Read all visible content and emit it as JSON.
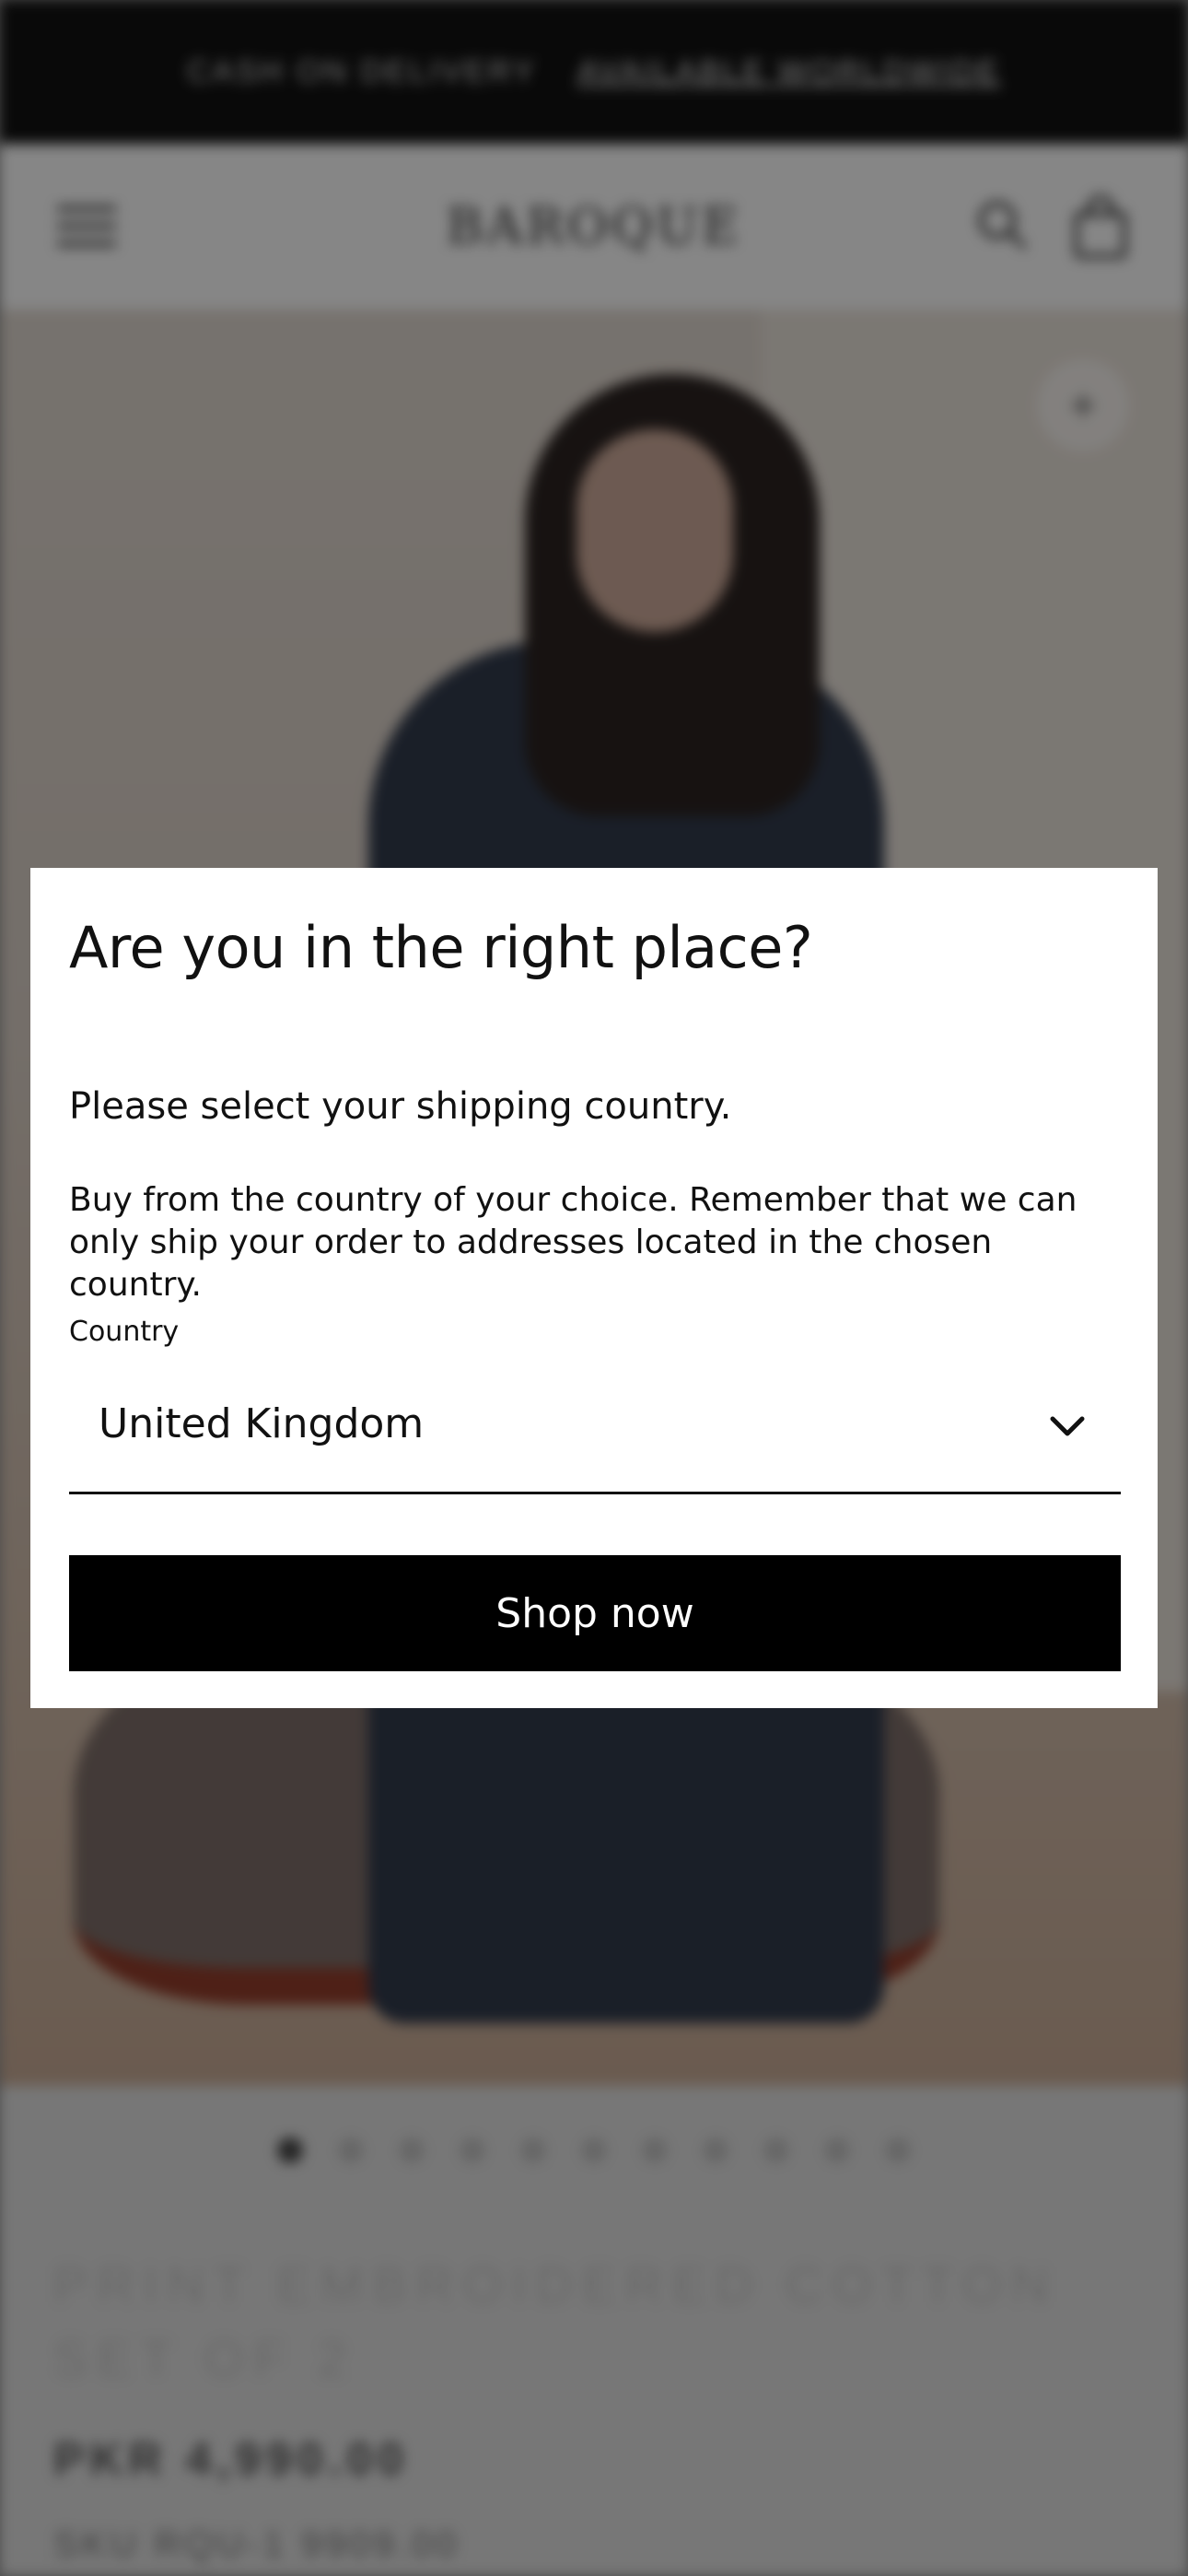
{
  "announcement": {
    "promo_text": "CASH ON DELIVERY",
    "link_text": "AVAILABLE WORLDWIDE"
  },
  "header": {
    "logo": "BAROQUE",
    "menu_icon": "hamburger-menu-icon",
    "search_icon": "search-icon",
    "cart_icon": "shopping-bag-icon"
  },
  "hero": {
    "zoom_icon": "plus-icon",
    "zoom_symbol": "+",
    "slide_count": 11,
    "active_slide": 1
  },
  "product": {
    "title": "PRINT EMBROIDERED COTTON SET OF 2",
    "price": "PKR 4,990.00",
    "sub": "SKU RQU-1 9909.00"
  },
  "modal": {
    "title": "Are you in the right place?",
    "subtitle": "Please select your shipping country.",
    "description": "Buy from the country of your choice. Remember that we can only ship your order to addresses located in the chosen country.",
    "country_label": "Country",
    "country_value": "United Kingdom",
    "select_icon": "chevron-down-icon",
    "button_label": "Shop now"
  },
  "colors": {
    "overlay": "#000000",
    "button_bg": "#000000",
    "button_text": "#ffffff",
    "modal_bg": "#ffffff"
  }
}
